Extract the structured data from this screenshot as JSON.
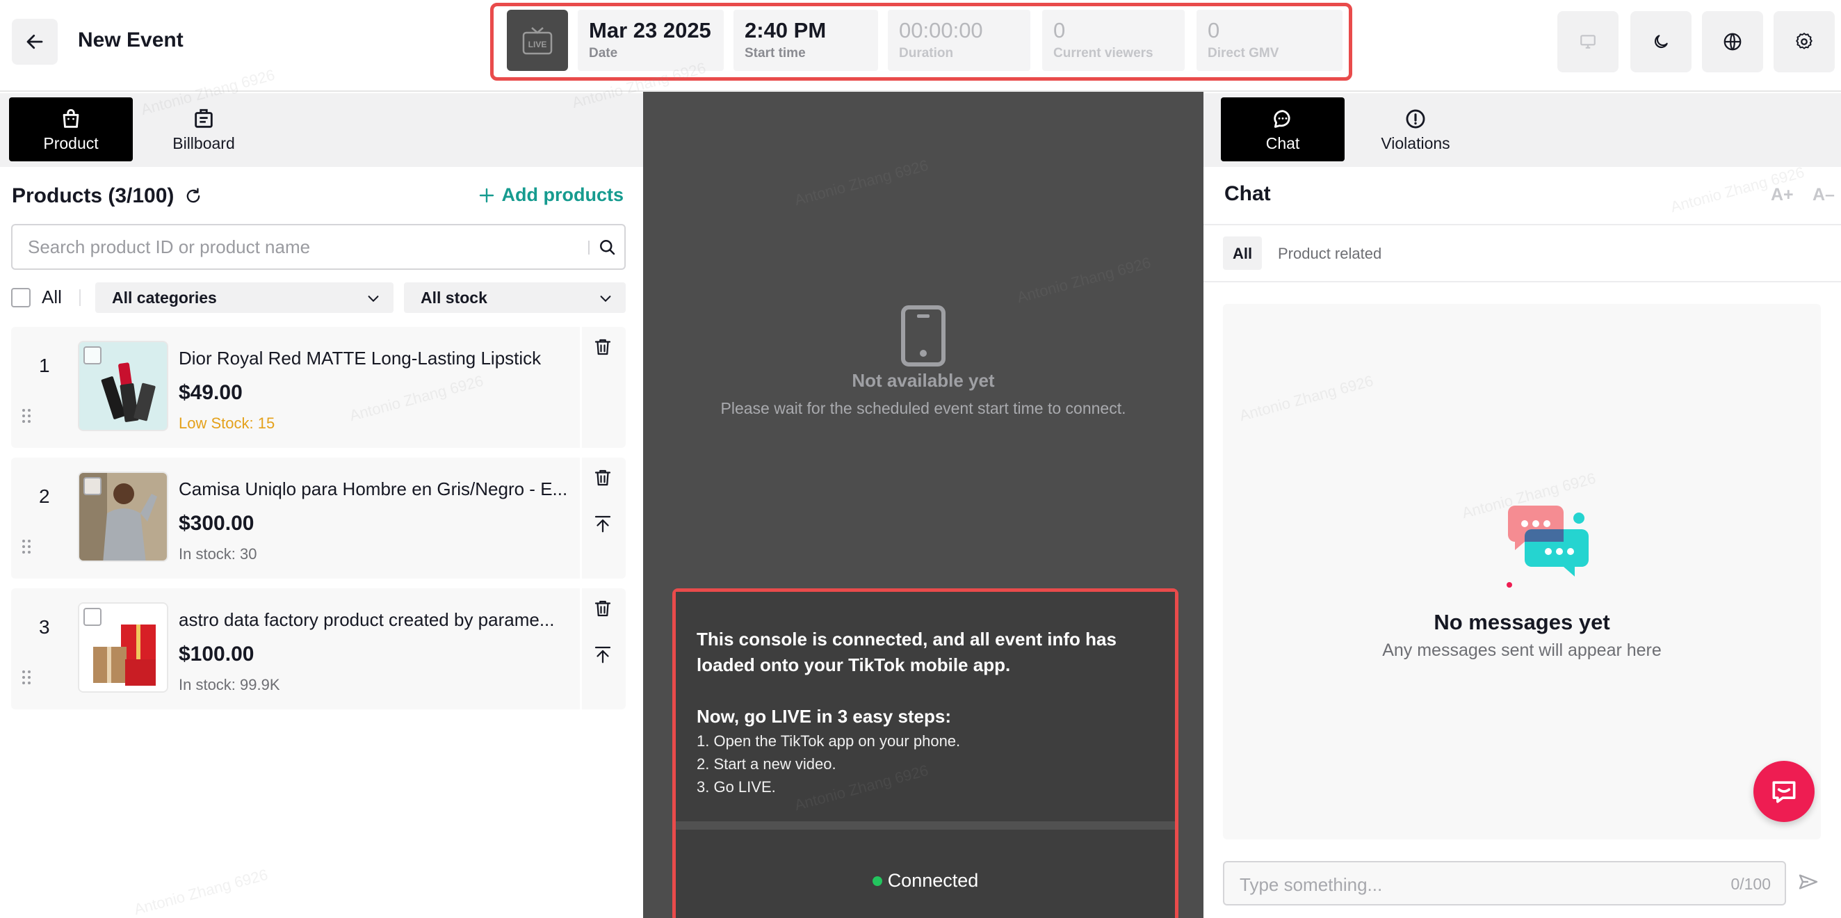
{
  "header": {
    "title": "New Event",
    "live_badge": "LIVE",
    "stats": [
      {
        "value": "Mar 23 2025",
        "label": "Date"
      },
      {
        "value": "2:40 PM",
        "label": "Start time"
      },
      {
        "value": "00:00:00",
        "label": "Duration"
      },
      {
        "value": "0",
        "label": "Current viewers"
      },
      {
        "value": "0",
        "label": "Direct GMV"
      }
    ]
  },
  "left": {
    "tabs": [
      {
        "label": "Product",
        "icon": "shopping-bag-icon",
        "active": true
      },
      {
        "label": "Billboard",
        "icon": "billboard-icon",
        "active": false
      }
    ],
    "products_title": "Products (3/100)",
    "add_products": "Add products",
    "search_placeholder": "Search product ID or product name",
    "all_label": "All",
    "category_filter": "All categories",
    "stock_filter": "All stock",
    "products": [
      {
        "index": "1",
        "name": "Dior Royal Red MATTE Long-Lasting Lipstick",
        "price": "$49.00",
        "stock": "Low Stock: 15",
        "low": true
      },
      {
        "index": "2",
        "name": "Camisa Uniqlo para Hombre en Gris/Negro - E...",
        "price": "$300.00",
        "stock": "In stock: 30",
        "low": false
      },
      {
        "index": "3",
        "name": "astro data factory product created by parame...",
        "price": "$100.00",
        "stock": "In stock: 99.9K",
        "low": false
      }
    ]
  },
  "middle": {
    "not_available_title": "Not available yet",
    "not_available_sub": "Please wait for the scheduled event start time to connect.",
    "connected_line1": "This console is connected, and all event info has loaded onto your TikTok mobile app.",
    "steps_title": "Now, go LIVE in 3 easy steps:",
    "steps": [
      "1. Open the TikTok app on your phone.",
      "2. Start a new video.",
      "3. Go LIVE."
    ],
    "status": "Connected"
  },
  "right": {
    "tabs": [
      {
        "label": "Chat",
        "icon": "chat-bubble-icon",
        "active": true
      },
      {
        "label": "Violations",
        "icon": "alert-circle-icon",
        "active": false
      }
    ],
    "title": "Chat",
    "font_increase": "A+",
    "font_decrease": "A–",
    "filters": [
      "All",
      "Product related"
    ],
    "empty_title": "No messages yet",
    "empty_sub": "Any messages sent will appear here",
    "input_placeholder": "Type something...",
    "input_counter": "0/100"
  },
  "colors": {
    "accent_red": "#e94b4b",
    "teal": "#169b8f",
    "low_stock": "#e4a11b",
    "connected_green": "#23c55e",
    "fab": "#ee1d52"
  },
  "watermark": "Antonio Zhang 6926"
}
